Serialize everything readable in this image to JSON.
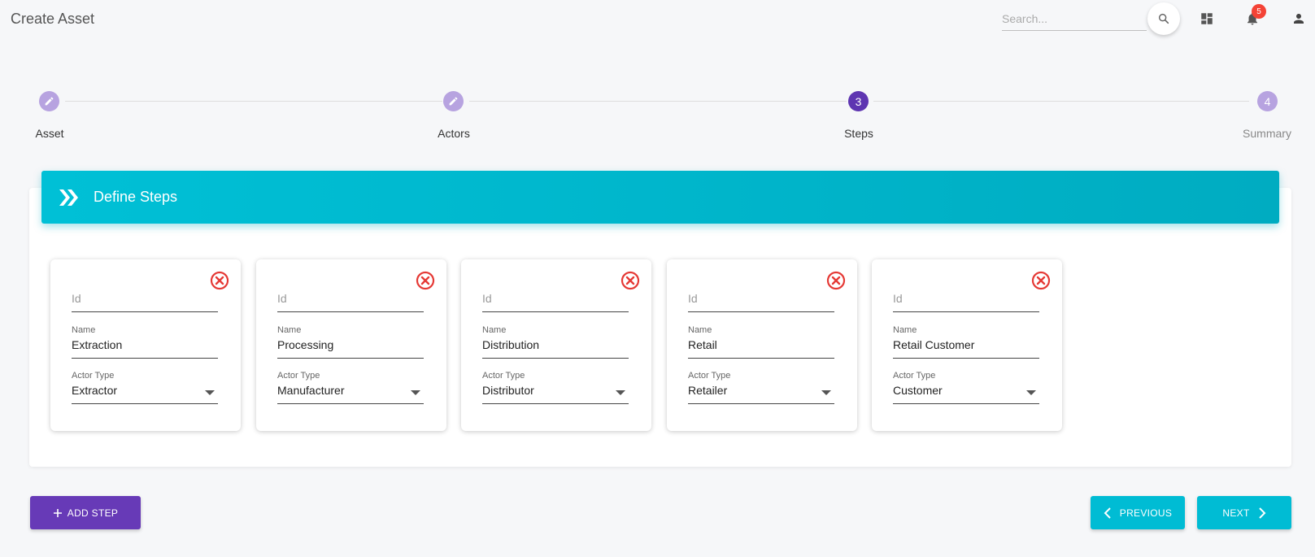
{
  "header": {
    "title": "Create Asset",
    "search_placeholder": "Search...",
    "notification_count": "5"
  },
  "stepper": [
    {
      "label": "Asset",
      "state": "done",
      "marker": "edit-icon"
    },
    {
      "label": "Actors",
      "state": "done",
      "marker": "edit-icon"
    },
    {
      "label": "Steps",
      "state": "active",
      "number": "3"
    },
    {
      "label": "Summary",
      "state": "future",
      "number": "4"
    }
  ],
  "panel": {
    "title": "Define Steps",
    "icon": "double-chevron-right-icon"
  },
  "field_labels": {
    "id_placeholder": "Id",
    "name": "Name",
    "actor_type": "Actor Type"
  },
  "steps": [
    {
      "id": "",
      "name": "Extraction",
      "actor_type": "Extractor"
    },
    {
      "id": "",
      "name": "Processing",
      "actor_type": "Manufacturer"
    },
    {
      "id": "",
      "name": "Distribution",
      "actor_type": "Distributor"
    },
    {
      "id": "",
      "name": "Retail",
      "actor_type": "Retailer"
    },
    {
      "id": "",
      "name": "Retail Customer",
      "actor_type": "Customer"
    }
  ],
  "buttons": {
    "add_step": "ADD STEP",
    "previous": "PREVIOUS",
    "next": "NEXT"
  },
  "colors": {
    "accent": "#00bcd4",
    "primary": "#673ab7",
    "remove": "#e53935",
    "badge": "#f44336"
  }
}
